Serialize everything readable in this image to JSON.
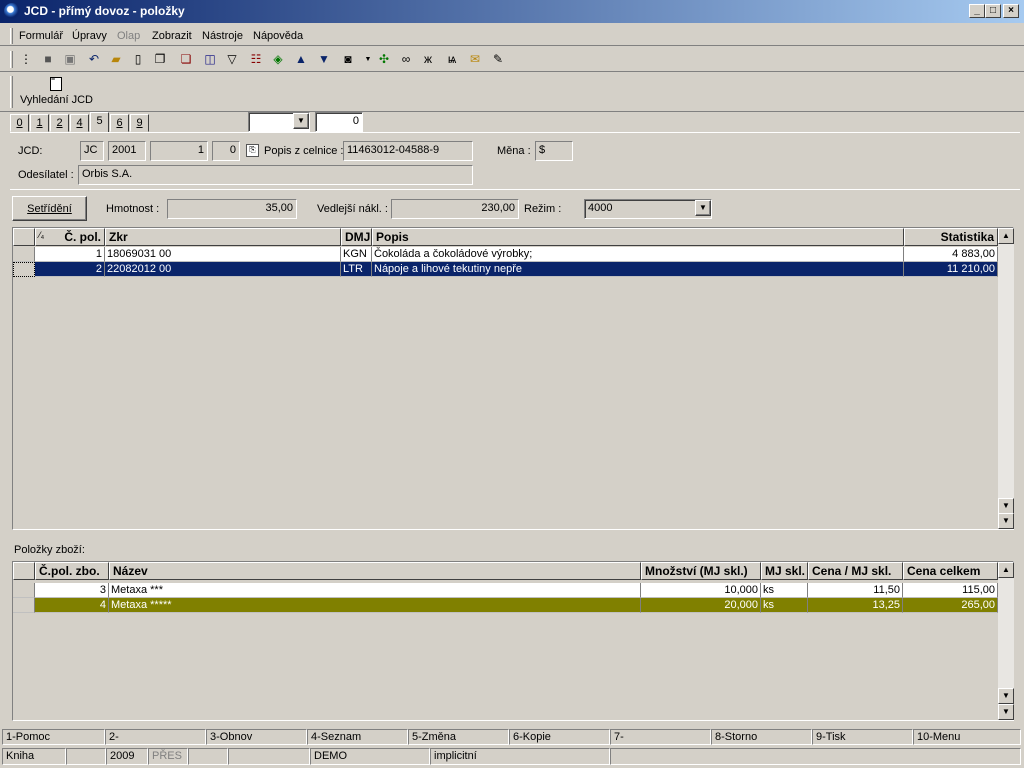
{
  "window": {
    "title": "JCD - přímý dovoz - položky"
  },
  "menu": [
    "Formulář",
    "Úpravy",
    "Olap",
    "Zobrazit",
    "Nástroje",
    "Nápověda"
  ],
  "toolbar2": {
    "search_label": "Vyhledání JCD"
  },
  "tabs": [
    "0",
    "1",
    "2",
    "4",
    "5",
    "6",
    "9"
  ],
  "top_controls": {
    "combo_value": "",
    "number_value": "0"
  },
  "header": {
    "jcd_label": "JCD:",
    "jcd_type": "JC",
    "jcd_year": "2001",
    "jcd_num": "1",
    "jcd_sub": "0",
    "popis_label": "Popis z celnice :",
    "popis_value": "11463012-04588-9",
    "mena_label": "Měna :",
    "mena_value": "$",
    "odesilatel_label": "Odesílatel :",
    "odesilatel_value": "Orbis S.A."
  },
  "controls": {
    "sort_button": "Setřídění",
    "hmotnost_label": "Hmotnost :",
    "hmotnost_value": "35,00",
    "vedlejsi_label": "Vedlejší nákl. :",
    "vedlejsi_value": "230,00",
    "rezim_label": "Režim :",
    "rezim_value": "4000"
  },
  "grid1": {
    "headers": [
      "Č. pol.",
      "Zkr",
      "DMJ",
      "Popis",
      "Statistika"
    ],
    "rows": [
      [
        "1",
        "18069031 00",
        "KGN",
        "Čokoláda a čokoládové výrobky;",
        "4 883,00"
      ],
      [
        "2",
        "22082012 00",
        "LTR",
        "Nápoje a lihové tekutiny nepře",
        "11 210,00"
      ]
    ]
  },
  "items_label": "Položky zboží:",
  "grid2": {
    "headers": [
      "Č.pol. zbo.",
      "Název",
      "Množství (MJ skl.)",
      "MJ skl.",
      "Cena / MJ skl.",
      "Cena celkem"
    ],
    "rows": [
      [
        "3",
        "Metaxa ***",
        "10,000",
        "ks",
        "11,50",
        "115,00"
      ],
      [
        "4",
        "Metaxa *****",
        "20,000",
        "ks",
        "13,25",
        "265,00"
      ]
    ]
  },
  "fkeys": [
    "1-Pomoc",
    "2-",
    "3-Obnov",
    "4-Seznam",
    "5-Změna",
    "6-Kopie",
    "7-",
    "8-Storno",
    "9-Tisk",
    "10-Menu"
  ],
  "status": [
    "Kniha",
    "",
    "2009",
    "PŘES",
    "",
    "",
    "DEMO",
    "implicitní",
    ""
  ],
  "colors": {
    "title_start": "#0a246a",
    "selected_row": "#0a246a",
    "highlight_row": "#808000"
  }
}
